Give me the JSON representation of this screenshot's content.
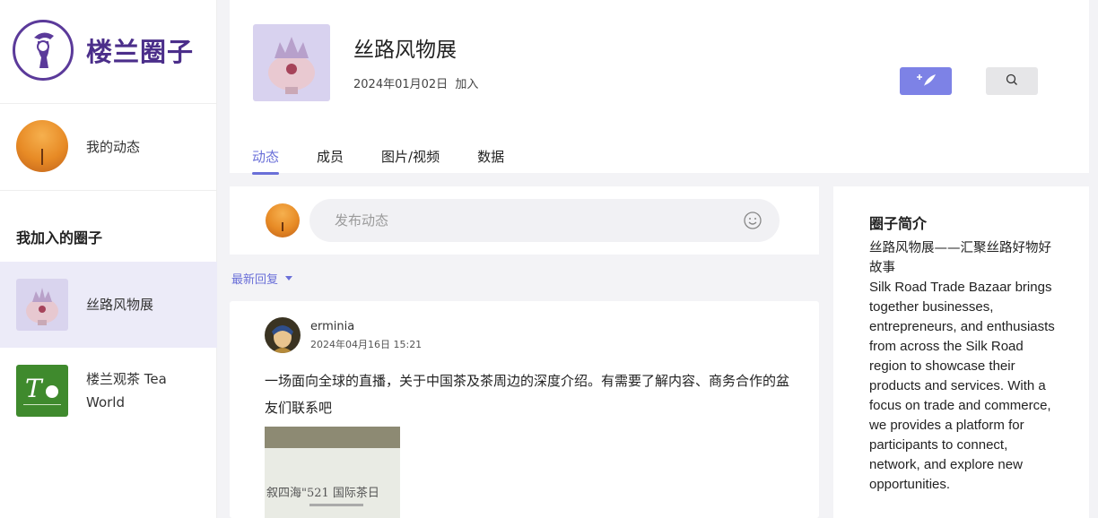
{
  "sidebar": {
    "brand": {
      "name": "楼兰圈子",
      "logo_icon": "loulan-portrait-logo-icon"
    },
    "my_activity": {
      "label": "我的动态",
      "avatar_icon": "orange-avatar-icon"
    },
    "section_title": "我加入的圈子",
    "circles": [
      {
        "label": "丝路风物展",
        "active": true,
        "thumb_icon": "silk-road-vase-thumbnail"
      },
      {
        "label": "楼兰观茶 Tea World",
        "active": false,
        "thumb_icon": "tea-world-logo"
      }
    ]
  },
  "header": {
    "title": "丝路风物展",
    "joined_date": "2024年01月02日",
    "joined_suffix": "加入",
    "post_button_icon": "add-quill-icon",
    "search_button_icon": "search-icon",
    "tabs": [
      {
        "label": "动态",
        "active": true
      },
      {
        "label": "成员",
        "active": false
      },
      {
        "label": "图片/视频",
        "active": false
      },
      {
        "label": "数据",
        "active": false
      }
    ]
  },
  "composer": {
    "placeholder": "发布动态",
    "emoji_icon": "smile-icon"
  },
  "sort": {
    "label": "最新回复"
  },
  "post": {
    "author": "erminia",
    "time": "2024年04月16日 15:21",
    "text": "一场面向全球的直播，关于中国茶及茶周边的深度介绍。有需要了解内容、商务合作的盆友们联系吧",
    "image_caption": "叙四海\"521 国际茶日"
  },
  "intro": {
    "title": "圈子简介",
    "text_cn": "丝路风物展——汇聚丝路好物好故事",
    "text_en": "Silk Road Trade Bazaar brings together businesses, entrepreneurs, and enthusiasts from across the Silk Road region to showcase their products and services. With a focus on trade and commerce, we provides a platform for participants to connect, network, and explore new opportunities."
  },
  "colors": {
    "accent": "#6a6fd8",
    "brand": "#4b2e8a",
    "active_bg": "#ecebf8"
  }
}
